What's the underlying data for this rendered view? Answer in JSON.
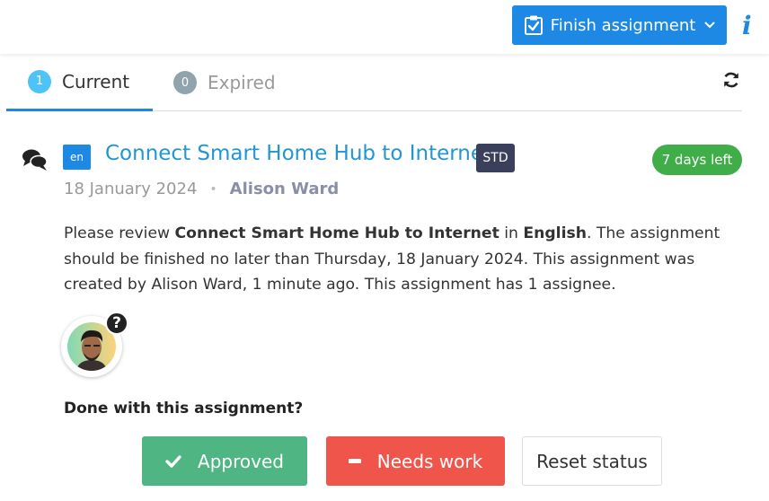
{
  "header": {
    "finish_button_label": "Finish assignment",
    "finish_button_icon": "clipboard-check-icon",
    "finish_chevron": "⌄",
    "info_icon": "i"
  },
  "tabs": [
    {
      "label": "Current",
      "count": "1",
      "active": true
    },
    {
      "label": "Expired",
      "count": "0",
      "active": false
    }
  ],
  "assignment": {
    "language_code": "en",
    "title": "Connect Smart Home Hub to Internet",
    "type_badge": "STD",
    "days_left": "7 days left",
    "date": "18 January 2024",
    "separator": "•",
    "author": "Alison Ward",
    "description": {
      "p1": "Please review ",
      "title_bold": "Connect Smart Home Hub to Internet",
      "p2": " in ",
      "language_bold": "English",
      "p3": ". The assignment should be finished no later than Thursday, 18 January 2024. This assignment was created by Alison Ward, 1 minute ago. This assignment has 1 assignee."
    },
    "assignee_status_icon": "?"
  },
  "actions": {
    "prompt": "Done with this assignment?",
    "approved_label": "Approved",
    "needs_work_label": "Needs work",
    "reset_label": "Reset status"
  },
  "colors": {
    "primary": "#1e88e5",
    "approved": "#4fb583",
    "needs_work": "#f0554b",
    "days_left": "#3fae49",
    "type_badge": "#3a3f5c"
  }
}
